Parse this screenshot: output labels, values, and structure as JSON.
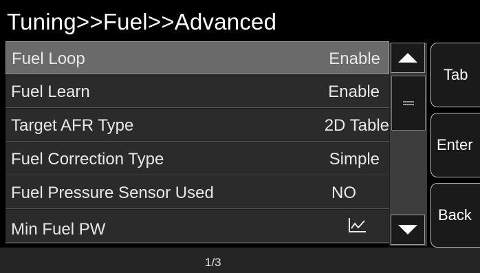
{
  "title": "Tuning>>Fuel>>Advanced",
  "rows": [
    {
      "label": "Fuel Loop",
      "value": "Enable"
    },
    {
      "label": "Fuel Learn",
      "value": "Enable"
    },
    {
      "label": "Target AFR Type",
      "value": "2D Table"
    },
    {
      "label": "Fuel Correction Type",
      "value": "Simple"
    },
    {
      "label": "Fuel Pressure Sensor Used",
      "value": "NO"
    },
    {
      "label": "Min Fuel PW",
      "value": "",
      "icon": "graph-icon"
    }
  ],
  "side_buttons": {
    "tab": "Tab",
    "enter": "Enter",
    "back": "Back"
  },
  "footer": {
    "page": "1/3"
  },
  "colors": {
    "background": "#000000",
    "row": "#2b2b2b",
    "selected_row": "#6a6a6a",
    "text": "#e8e8e8"
  }
}
